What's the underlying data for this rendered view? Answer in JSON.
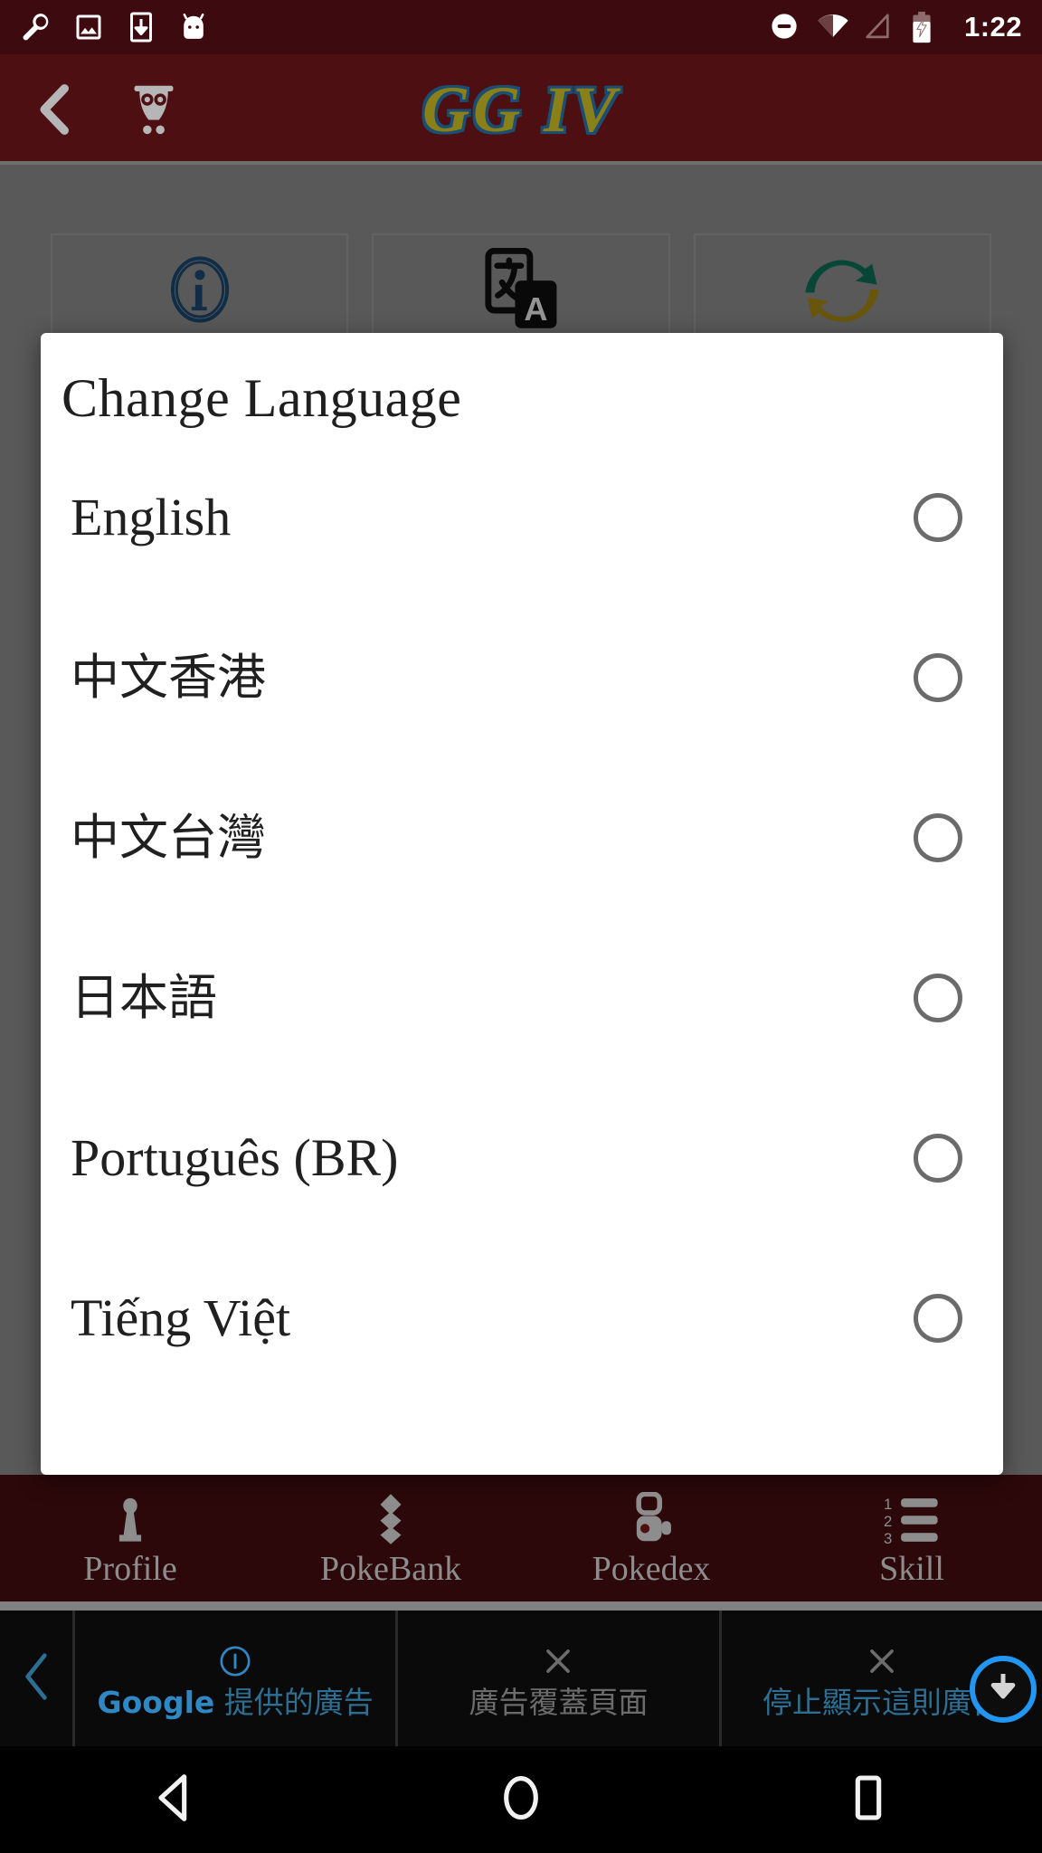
{
  "status_bar": {
    "time": "1:22",
    "left_icons": [
      "wrench-icon",
      "image-icon",
      "download-icon",
      "android-head-icon"
    ],
    "right_icons": [
      "do-not-disturb-icon",
      "wifi-icon",
      "cellular-signal-icon",
      "battery-charging-icon"
    ],
    "background_color": "#3d0b0f"
  },
  "app_bar": {
    "back_label": "back-icon",
    "owl_label": "owl-icon",
    "title": "GG IV",
    "title_color": "#8a8019",
    "title_outline_color": "#1b4e72",
    "background_color": "#4d0f12"
  },
  "background_cards": [
    {
      "icon": "info-icon",
      "color": "#1e4f7a"
    },
    {
      "icon": "translate-icon",
      "color": "#111111"
    },
    {
      "icon": "sync-refresh-icon",
      "color": "#0e7a5f"
    }
  ],
  "dialog": {
    "title": "Change Language",
    "languages": [
      {
        "label": "English",
        "script": "latin",
        "selected": false
      },
      {
        "label": "中文香港",
        "script": "cjk",
        "selected": false
      },
      {
        "label": "中文台灣",
        "script": "cjk",
        "selected": false
      },
      {
        "label": "日本語",
        "script": "cjk",
        "selected": false
      },
      {
        "label": "Português (BR)",
        "script": "latin",
        "selected": false
      },
      {
        "label": "Tiếng Việt",
        "script": "latin",
        "selected": false
      }
    ],
    "radio_color": "#6b6b6b",
    "background_color": "#ffffff"
  },
  "bottom_nav": {
    "items": [
      {
        "label": "Profile",
        "icon": "person-icon"
      },
      {
        "label": "PokeBank",
        "icon": "stacked-diamonds-icon"
      },
      {
        "label": "Pokedex",
        "icon": "pokedex-device-icon"
      },
      {
        "label": "Skill",
        "icon": "numbered-list-icon"
      }
    ],
    "background_color": "#4d0f12",
    "label_color": "#8d8d8d"
  },
  "ad_strip": {
    "back_icon": "chevron-left-icon",
    "cells": [
      {
        "icon": "info-circle-icon",
        "text_prefix": "Google",
        "text": " 提供的廣告",
        "color": "#2f87c4"
      },
      {
        "icon": "close-x-icon",
        "text_prefix": "",
        "text": "廣告覆蓋頁面",
        "color": "#6b6b6b"
      },
      {
        "icon": "close-x-icon",
        "text_prefix": "",
        "text": "停止顯示這則廣告",
        "color": "#2d6f93"
      }
    ],
    "fab_icon": "download-arrow-icon",
    "fab_ring_color": "#2196f3",
    "background_color": "#0a0a0a"
  },
  "android_nav": {
    "items": [
      "back-triangle-icon",
      "home-circle-icon",
      "recents-square-icon"
    ],
    "background_color": "#000000"
  }
}
